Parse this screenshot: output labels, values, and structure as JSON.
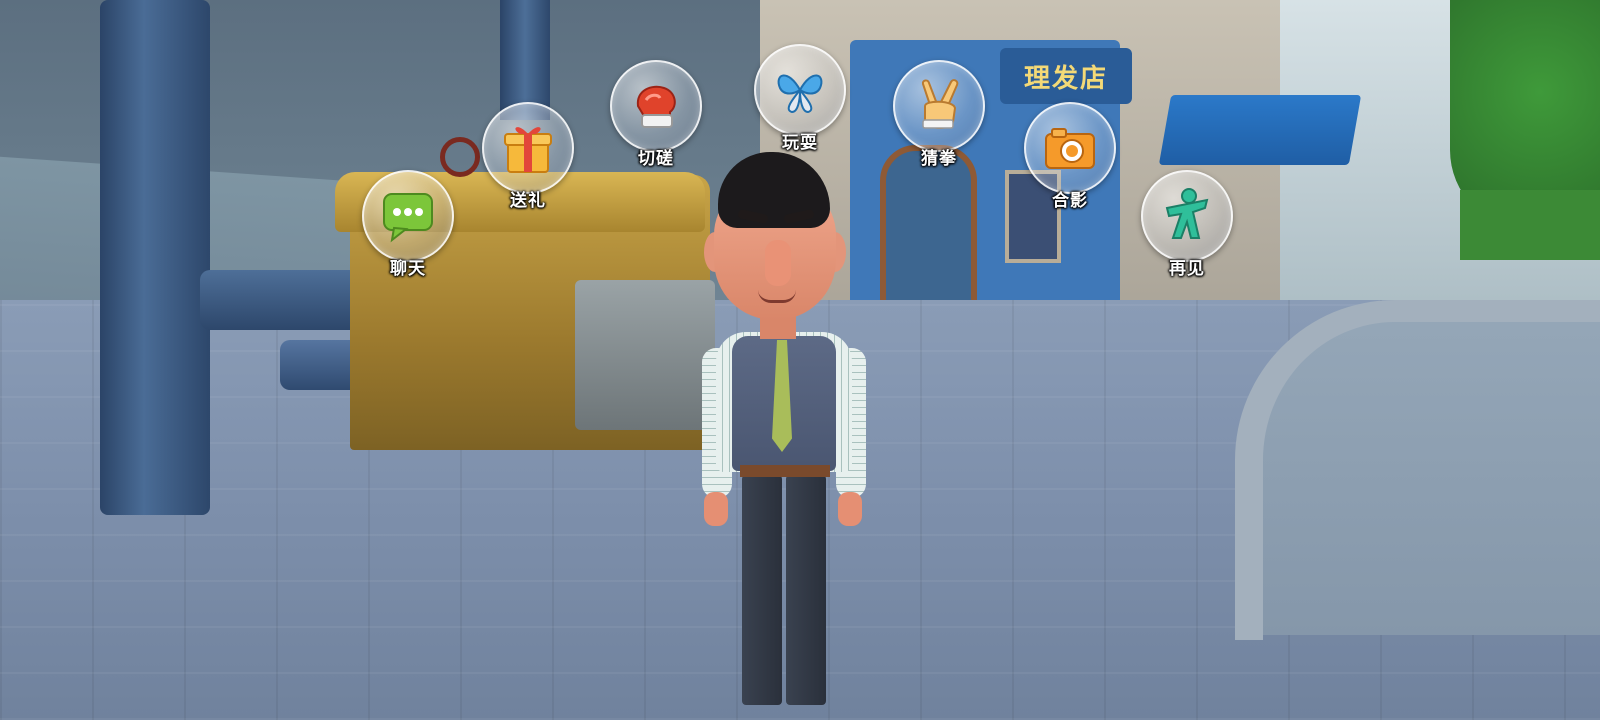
{
  "scene": {
    "shop_sign": "理发店"
  },
  "actions": [
    {
      "id": "chat",
      "label": "聊天",
      "icon": "chat-bubble-icon",
      "color": "#7cc63a"
    },
    {
      "id": "gift",
      "label": "送礼",
      "icon": "gift-box-icon",
      "color": "#f2a42b"
    },
    {
      "id": "spar",
      "label": "切磋",
      "icon": "boxing-glove-icon",
      "color": "#e0432b"
    },
    {
      "id": "play",
      "label": "玩耍",
      "icon": "butterfly-icon",
      "color": "#4aa8e8"
    },
    {
      "id": "rps",
      "label": "猜拳",
      "icon": "victory-hand-icon",
      "color": "#f5b45a"
    },
    {
      "id": "photo",
      "label": "合影",
      "icon": "camera-icon",
      "color": "#f59a2a"
    },
    {
      "id": "bye",
      "label": "再见",
      "icon": "waving-person-icon",
      "color": "#2fbf9a"
    }
  ]
}
